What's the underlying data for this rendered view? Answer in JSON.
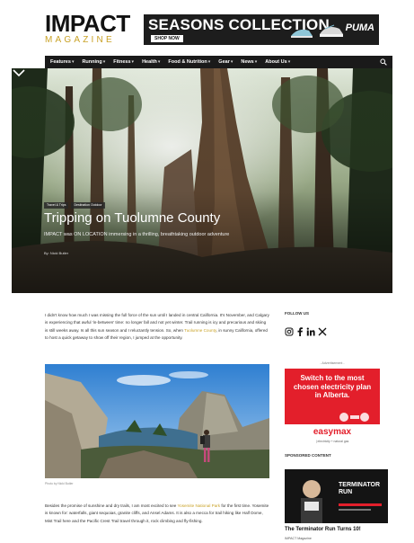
{
  "header": {
    "logo_main": "IMPACT",
    "logo_sub": "MAGAZINE",
    "ad": {
      "title": "SEASONS COLLECTION",
      "shop_label": "SHOP NOW",
      "brand": "PUMA"
    }
  },
  "nav": {
    "items": [
      {
        "label": "Features"
      },
      {
        "label": "Running"
      },
      {
        "label": "Fitness"
      },
      {
        "label": "Health"
      },
      {
        "label": "Food & Nutrition"
      },
      {
        "label": "Gear"
      },
      {
        "label": "News"
      },
      {
        "label": "About Us"
      }
    ],
    "caret": "▾"
  },
  "hero": {
    "tags": [
      "Travel & Trips",
      "Destination Outdoor"
    ],
    "title": "Tripping on Tuolumne County",
    "subtitle": "IMPACT was ON LOCATION immersing in a thrilling, breathtaking outdoor adventure",
    "byline": "By: Nicki Butler"
  },
  "article": {
    "para1_a": "I didn't know how much I was missing the full force of the sun until I landed in central California. It's November, and Calgary is experiencing that awful 'in-between' time: no longer fall and not yet winter. Trail running is icy and precarious and skiing is still weeks away. Is all this sun season and I reluctantly tension. So, when ",
    "para1_link": "Tuolumne County",
    "para1_b": ", in sunny California, offered to host a quick getaway to show off their region, I jumped at the opportunity.",
    "caption": "Photo by Nicki Butler",
    "para2_a": "Besides the promise of sunshine and dry trails, I am most excited to see ",
    "para2_link": "Yosemite National Park",
    "para2_b": " for the first time. Yosemite is known for: waterfalls, giant sequoias, granite cliffs, and Ansel Adams. It is also a mecca for trail hiking like Half Dome, Mist Trail here and the Pacific Crest Trail travel through it, rock climbing and fly-fishing."
  },
  "sidebar": {
    "follow_label": "FOLLOW US",
    "social_icons": [
      "instagram-icon",
      "facebook-icon",
      "linkedin-icon",
      "x-icon"
    ],
    "ad_label": "- Advertisement -",
    "ad_text": "Switch to the most chosen electricity plan in Alberta.",
    "ad_brand": "easymax",
    "ad_tagline": "| electricity + natural gas",
    "sponsored_label": "SPONSORED CONTENT",
    "sponsor_img_text": "TERMINATOR RUN",
    "sponsor_title": "The Terminator Run Turns 10!",
    "sponsor_source": "IMPACT Magazine"
  },
  "colors": {
    "accent_gold": "#c9a227",
    "nav_bg": "#1a1a1a",
    "ad_red": "#e31f2b"
  }
}
